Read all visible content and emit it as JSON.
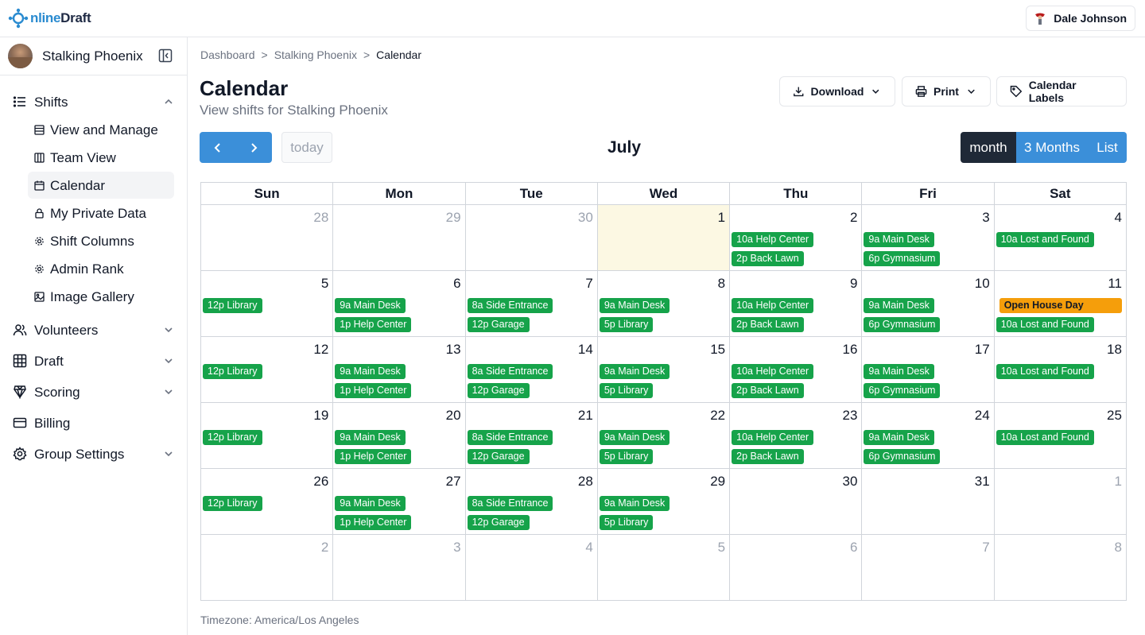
{
  "app": {
    "logo_prefix": "O",
    "logo_mid": "nline",
    "logo_suffix": "Draft",
    "user_name": "Dale Johnson"
  },
  "sidebar": {
    "org_name": "Stalking Phoenix",
    "items": [
      {
        "label": "Shifts",
        "icon": "list-icon",
        "expanded": true
      },
      {
        "label": "Volunteers",
        "icon": "users-icon"
      },
      {
        "label": "Draft",
        "icon": "grid-icon"
      },
      {
        "label": "Scoring",
        "icon": "trophy-icon"
      },
      {
        "label": "Billing",
        "icon": "card-icon"
      },
      {
        "label": "Group Settings",
        "icon": "gear-icon"
      }
    ],
    "shift_subitems": [
      {
        "label": "View and Manage",
        "icon": "table-icon"
      },
      {
        "label": "Team View",
        "icon": "columns-icon"
      },
      {
        "label": "Calendar",
        "icon": "calendar-icon",
        "active": true
      },
      {
        "label": "My Private Data",
        "icon": "lock-icon"
      },
      {
        "label": "Shift Columns",
        "icon": "gear-icon"
      },
      {
        "label": "Admin Rank",
        "icon": "gear-icon"
      },
      {
        "label": "Image Gallery",
        "icon": "image-icon"
      }
    ]
  },
  "breadcrumb": {
    "items": [
      "Dashboard",
      "Stalking Phoenix",
      "Calendar"
    ],
    "separator": ">"
  },
  "header": {
    "title": "Calendar",
    "subtitle": "View shifts for Stalking Phoenix",
    "download_label": "Download",
    "print_label": "Print",
    "labels_label": "Calendar Labels"
  },
  "toolbar": {
    "today_label": "today",
    "month_title": "July",
    "views": [
      "month",
      "3 Months",
      "List"
    ],
    "active_view": "month"
  },
  "calendar": {
    "weekdays": [
      "Sun",
      "Mon",
      "Tue",
      "Wed",
      "Thu",
      "Fri",
      "Sat"
    ],
    "weeks": [
      [
        {
          "d": "28",
          "other": true,
          "events": []
        },
        {
          "d": "29",
          "other": true,
          "events": []
        },
        {
          "d": "30",
          "other": true,
          "events": []
        },
        {
          "d": "1",
          "today": true,
          "events": []
        },
        {
          "d": "2",
          "events": [
            "10a Help Center",
            "2p Back Lawn"
          ]
        },
        {
          "d": "3",
          "events": [
            "9a Main Desk",
            "6p Gymnasium"
          ]
        },
        {
          "d": "4",
          "events": [
            "10a Lost and Found"
          ]
        }
      ],
      [
        {
          "d": "5",
          "events": [
            "12p Library"
          ]
        },
        {
          "d": "6",
          "events": [
            "9a Main Desk",
            "1p Help Center"
          ]
        },
        {
          "d": "7",
          "events": [
            "8a Side Entrance",
            "12p Garage"
          ]
        },
        {
          "d": "8",
          "events": [
            "9a Main Desk",
            "5p Library"
          ]
        },
        {
          "d": "9",
          "events": [
            "10a Help Center",
            "2p Back Lawn"
          ]
        },
        {
          "d": "10",
          "events": [
            "9a Main Desk",
            "6p Gymnasium"
          ]
        },
        {
          "d": "11",
          "allday": "Open House Day",
          "events": [
            "10a Lost and Found"
          ]
        }
      ],
      [
        {
          "d": "12",
          "events": [
            "12p Library"
          ]
        },
        {
          "d": "13",
          "events": [
            "9a Main Desk",
            "1p Help Center"
          ]
        },
        {
          "d": "14",
          "events": [
            "8a Side Entrance",
            "12p Garage"
          ]
        },
        {
          "d": "15",
          "events": [
            "9a Main Desk",
            "5p Library"
          ]
        },
        {
          "d": "16",
          "events": [
            "10a Help Center",
            "2p Back Lawn"
          ]
        },
        {
          "d": "17",
          "events": [
            "9a Main Desk",
            "6p Gymnasium"
          ]
        },
        {
          "d": "18",
          "events": [
            "10a Lost and Found"
          ]
        }
      ],
      [
        {
          "d": "19",
          "events": [
            "12p Library"
          ]
        },
        {
          "d": "20",
          "events": [
            "9a Main Desk",
            "1p Help Center"
          ]
        },
        {
          "d": "21",
          "events": [
            "8a Side Entrance",
            "12p Garage"
          ]
        },
        {
          "d": "22",
          "events": [
            "9a Main Desk",
            "5p Library"
          ]
        },
        {
          "d": "23",
          "events": [
            "10a Help Center",
            "2p Back Lawn"
          ]
        },
        {
          "d": "24",
          "events": [
            "9a Main Desk",
            "6p Gymnasium"
          ]
        },
        {
          "d": "25",
          "events": [
            "10a Lost and Found"
          ]
        }
      ],
      [
        {
          "d": "26",
          "events": [
            "12p Library"
          ]
        },
        {
          "d": "27",
          "events": [
            "9a Main Desk",
            "1p Help Center"
          ]
        },
        {
          "d": "28",
          "events": [
            "8a Side Entrance",
            "12p Garage"
          ]
        },
        {
          "d": "29",
          "events": [
            "9a Main Desk",
            "5p Library"
          ]
        },
        {
          "d": "30",
          "events": []
        },
        {
          "d": "31",
          "events": []
        },
        {
          "d": "1",
          "other": true,
          "events": []
        }
      ],
      [
        {
          "d": "2",
          "other": true,
          "events": []
        },
        {
          "d": "3",
          "other": true,
          "events": []
        },
        {
          "d": "4",
          "other": true,
          "events": []
        },
        {
          "d": "5",
          "other": true,
          "events": []
        },
        {
          "d": "6",
          "other": true,
          "events": []
        },
        {
          "d": "7",
          "other": true,
          "events": []
        },
        {
          "d": "8",
          "other": true,
          "events": []
        }
      ]
    ]
  },
  "footer": {
    "timezone": "Timezone: America/Los Angeles"
  },
  "colors": {
    "accent": "#3b8fd9",
    "event_green": "#16a34a",
    "event_orange": "#f59e0b",
    "today_bg": "#fcf8e3",
    "active_view": "#1f2937"
  }
}
